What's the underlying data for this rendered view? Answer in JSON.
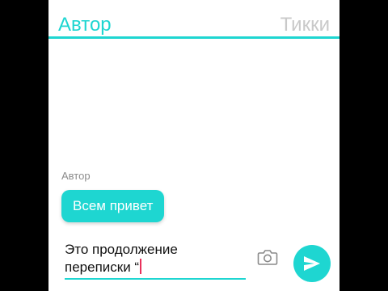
{
  "header": {
    "left_tab": "Автор",
    "right_tab": "Тикки"
  },
  "colors": {
    "accent": "#1ed6d1",
    "inactive_tab": "#c9c9c9",
    "caret": "#e8315b",
    "sender_name": "#8c8c8c"
  },
  "messages": [
    {
      "sender": "Автор",
      "text": "Всем привет"
    }
  ],
  "composer": {
    "line1": "Это продолжение",
    "line2": "переписки “",
    "camera_icon": "camera-icon",
    "send_icon": "send-icon"
  }
}
